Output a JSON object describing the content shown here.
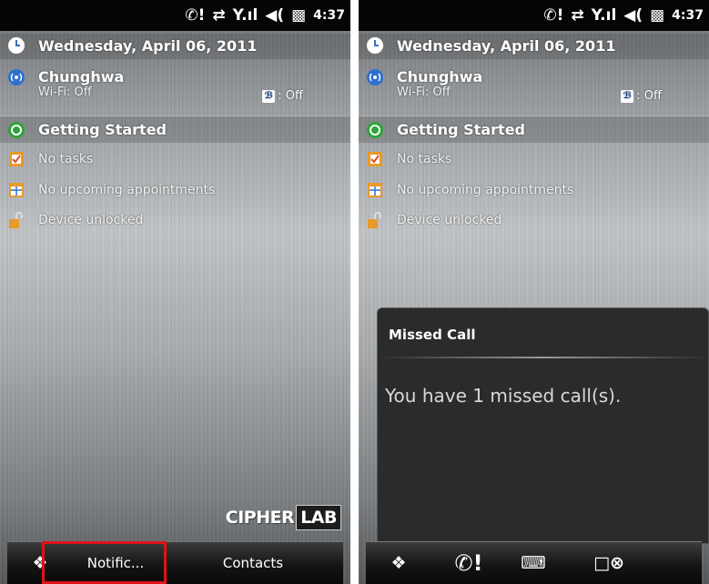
{
  "status": {
    "time": "4:37"
  },
  "today": {
    "date": "Wednesday, April 06, 2011",
    "operator": "Chunghwa",
    "wifi": "Wi-Fi: Off",
    "bluetooth": ": Off",
    "getting_started": "Getting Started",
    "tasks": "No tasks",
    "appointments": "No upcoming appointments",
    "lock": "Device unlocked"
  },
  "brand": {
    "part1": "CIPHER",
    "part2": "LAB"
  },
  "softkeys": {
    "left": "Notific...",
    "right": "Contacts"
  },
  "popup": {
    "title": "Missed Call",
    "message": "You have 1 missed call(s)."
  },
  "colors": {
    "highlight": "#e0121a"
  }
}
